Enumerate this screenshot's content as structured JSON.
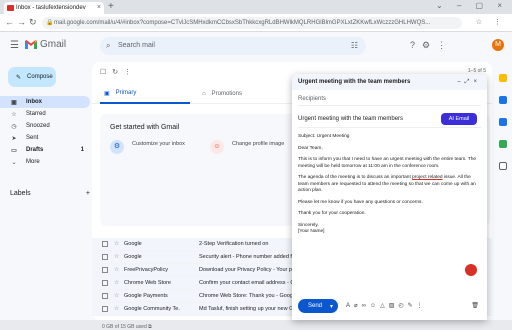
{
  "browser": {
    "tab_title": "Inbox - taslufextensiondev",
    "url": "mail.google.com/mail/u/4/#inbox?compose=CTvlJcSMHxdkmCCbsxSbThkkcxgRLdBHWlkMQLRHGlBlmGPXLxtZKKwfLxWczzzGHLHWQS..."
  },
  "gmail": {
    "logo_text": "Gmail",
    "search_placeholder": "Search mail",
    "avatar_letter": "M",
    "compose_label": "Compose",
    "sidebar": [
      {
        "icon": "inbox-icon",
        "label": "Inbox",
        "count": "",
        "active": true
      },
      {
        "icon": "star-icon",
        "label": "Starred",
        "count": ""
      },
      {
        "icon": "clock-icon",
        "label": "Snoozed",
        "count": ""
      },
      {
        "icon": "send-icon",
        "label": "Sent",
        "count": ""
      },
      {
        "icon": "draft-icon",
        "label": "Drafts",
        "count": "1"
      },
      {
        "icon": "chevron-down-icon",
        "label": "More",
        "count": ""
      }
    ],
    "labels_heading": "Labels",
    "pager": "1–5 of 5",
    "tabs": {
      "primary": "Primary",
      "promotions": "Promotions"
    },
    "get_started": {
      "title": "Get started with Gmail",
      "card1": "Customize your inbox",
      "card2": "Change profile image"
    },
    "rows": [
      {
        "sender": "Google",
        "subject": "2-Step Verification turned on"
      },
      {
        "sender": "Google",
        "subject": "Security alert - Phone number added fo"
      },
      {
        "sender": "FreePrivacyPolicy",
        "subject": "Download your Privacy Policy - Your priv"
      },
      {
        "sender": "Chrome Web Store",
        "subject": "Confirm your contact email address - Co"
      },
      {
        "sender": "Google Payments",
        "subject": "Chrome Web Store: Thank you - Google"
      },
      {
        "sender": "Google Community Te.",
        "subject": "Md Tasluf, finish setting up your new Go"
      }
    ],
    "storage": "0 GB of 15 GB used",
    "terms": "Terms · Priva"
  },
  "compose": {
    "title": "Urgent meeting with the team members",
    "recipients_placeholder": "Recipients",
    "subject": "Urgent meeting with the team members",
    "ai_button": "AI Email",
    "body": {
      "subject_line": "Subject: Urgent Meeting",
      "greeting": "Dear Team,",
      "p1": "This is to inform you that I need to have an urgent meeting with the entire team. The meeting will be held tomorrow at 11:00 am in the conference room.",
      "p2a": "The agenda of the meeting is to discuss an important ",
      "p2u": "project related",
      "p2b": " issue. All the team members are requested to attend the meeting so that we can come up with an action plan.",
      "p3": "Please let me know if you have any questions or concerns.",
      "p4": "Thank you for your cooperation.",
      "closing": "Sincerely,",
      "name": "[Your Name]"
    },
    "send_label": "Send"
  }
}
